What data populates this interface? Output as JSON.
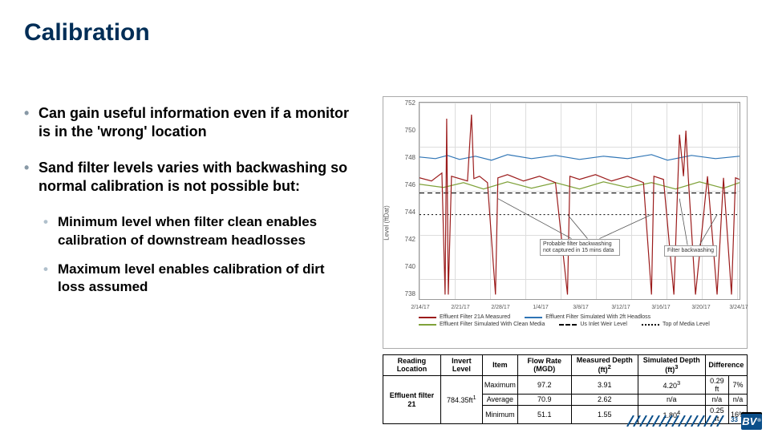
{
  "title": "Calibration",
  "bullets": {
    "b1": "Can gain useful information even if a monitor is in the 'wrong' location",
    "b2": "Sand filter levels varies with backwashing so normal calibration is not possible but:",
    "b3": "Minimum level when filter clean enables calibration of downstream headlosses",
    "b4": "Maximum level enables calibration of dirt loss assumed"
  },
  "chart_data": {
    "type": "line",
    "ylabel": "Level (ftDat)",
    "yticks": [
      "738",
      "740",
      "742",
      "744",
      "746",
      "748",
      "750",
      "752"
    ],
    "ylim": [
      738,
      752
    ],
    "xticks": [
      "2/14/17",
      "2/21/17",
      "2/28/17",
      "1/4/17",
      "3/8/17",
      "3/12/17",
      "3/16/17",
      "3/20/17",
      "3/24/17"
    ],
    "series": [
      {
        "name": "Effluent Filter 21A Measured",
        "color": "#9b1b1b",
        "style": "solid"
      },
      {
        "name": "Effluent Filter Simulated With 2ft Headloss",
        "color": "#2e74b5",
        "style": "solid"
      },
      {
        "name": "Effluent Filter Simulated With Clean Media",
        "color": "#7fa23a",
        "style": "solid"
      },
      {
        "name": "Us Inlet Weir Level",
        "color": "#000",
        "style": "dash"
      },
      {
        "name": "Top of Media Level",
        "color": "#000",
        "style": "dot"
      }
    ],
    "annotations": [
      {
        "text": "Probable filter backwashing not captured in 15 mins data",
        "x": 0.47,
        "y": 0.78
      },
      {
        "text": "Filter backwashing",
        "x": 0.8,
        "y": 0.78
      }
    ],
    "ref_levels": {
      "weir": 745.5,
      "media": 744
    }
  },
  "table": {
    "headers": [
      "Reading Location",
      "Invert Level",
      "Item",
      "Flow Rate (MGD)",
      "Measured Depth (ft)",
      "Simulated Depth (ft)",
      "Difference"
    ],
    "footnotes": {
      "invert": "1",
      "measured": "2",
      "simulated": "3",
      "sim_min": "4"
    },
    "rows": [
      {
        "loc": "Effluent filter 21",
        "invert": "784.35ft",
        "item": "Maximum",
        "flow": "97.2",
        "meas": "3.91",
        "sim": "4.20",
        "diff_ft": "0.29 ft",
        "diff_pc": "7%"
      },
      {
        "loc": "",
        "invert": "",
        "item": "Average",
        "flow": "70.9",
        "meas": "2.62",
        "sim": "n/a",
        "diff_ft": "n/a",
        "diff_pc": "n/a"
      },
      {
        "loc": "",
        "invert": "",
        "item": "Minimum",
        "flow": "51.1",
        "meas": "1.55",
        "sim": "1.80",
        "diff_ft": "0.25 ft",
        "diff_pc": "16%"
      }
    ]
  },
  "page_number": "33",
  "logo_text": "BV"
}
